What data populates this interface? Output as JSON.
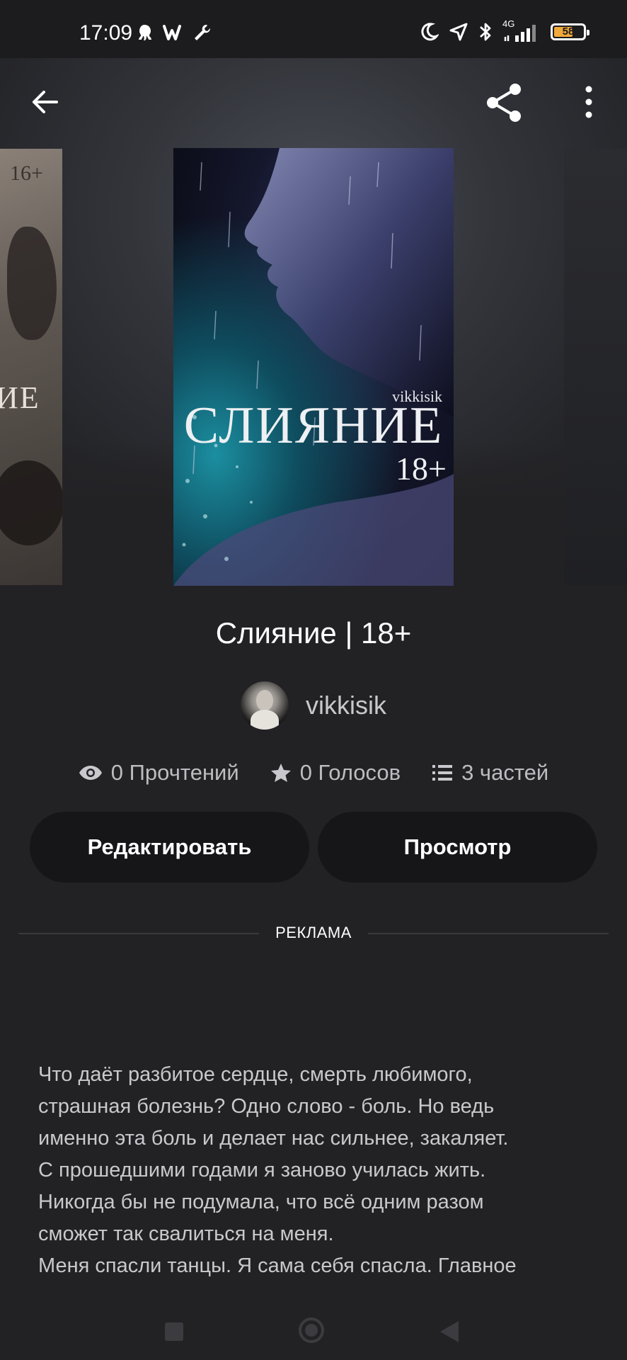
{
  "status_bar": {
    "time": "17:09",
    "network": "4G",
    "battery": "58",
    "battery_level": 0.58,
    "notification_icons": [
      "octopus-icon",
      "w-app-icon",
      "wrench-icon"
    ],
    "system_icons": [
      "moon-icon",
      "location-arrow-icon",
      "bluetooth-icon",
      "signal-icon",
      "battery-icon"
    ]
  },
  "header": {
    "back_icon": "arrow-left-icon",
    "share_icon": "share-icon",
    "more_icon": "more-vertical-icon"
  },
  "carousel": {
    "left_cover": {
      "age_tag": "16+",
      "title_fragment": "ИЕ"
    },
    "main_cover": {
      "author": "vikkisik",
      "title": "СЛИЯНИЕ",
      "age": "18+"
    }
  },
  "book": {
    "title": "Слияние | 18+",
    "author": "vikkisik",
    "stats": {
      "reads": "0 Прочтений",
      "votes": "0 Голосов",
      "parts": "3 частей"
    }
  },
  "actions": {
    "edit_label": "Редактировать",
    "preview_label": "Просмотр"
  },
  "ad": {
    "label": "РЕКЛАМА"
  },
  "description": "Что даёт разбитое сердце, смерть любимого,\nстрашная болезнь? Одно слово - боль. Но ведь\nименно эта боль и делает нас сильнее, закаляет.\nС прошедшими годами я заново училась жить.\nНикогда бы не подумала, что всё одним разом\nсможет так свалиться на меня.\nМеня спасли танцы. Я сама себя спасла. Главное",
  "colors": {
    "background": "#222124",
    "button_bg": "#161518",
    "text_primary": "#ffffff",
    "text_secondary": "#bdbcc1",
    "battery_accent": "#f2a93b"
  }
}
